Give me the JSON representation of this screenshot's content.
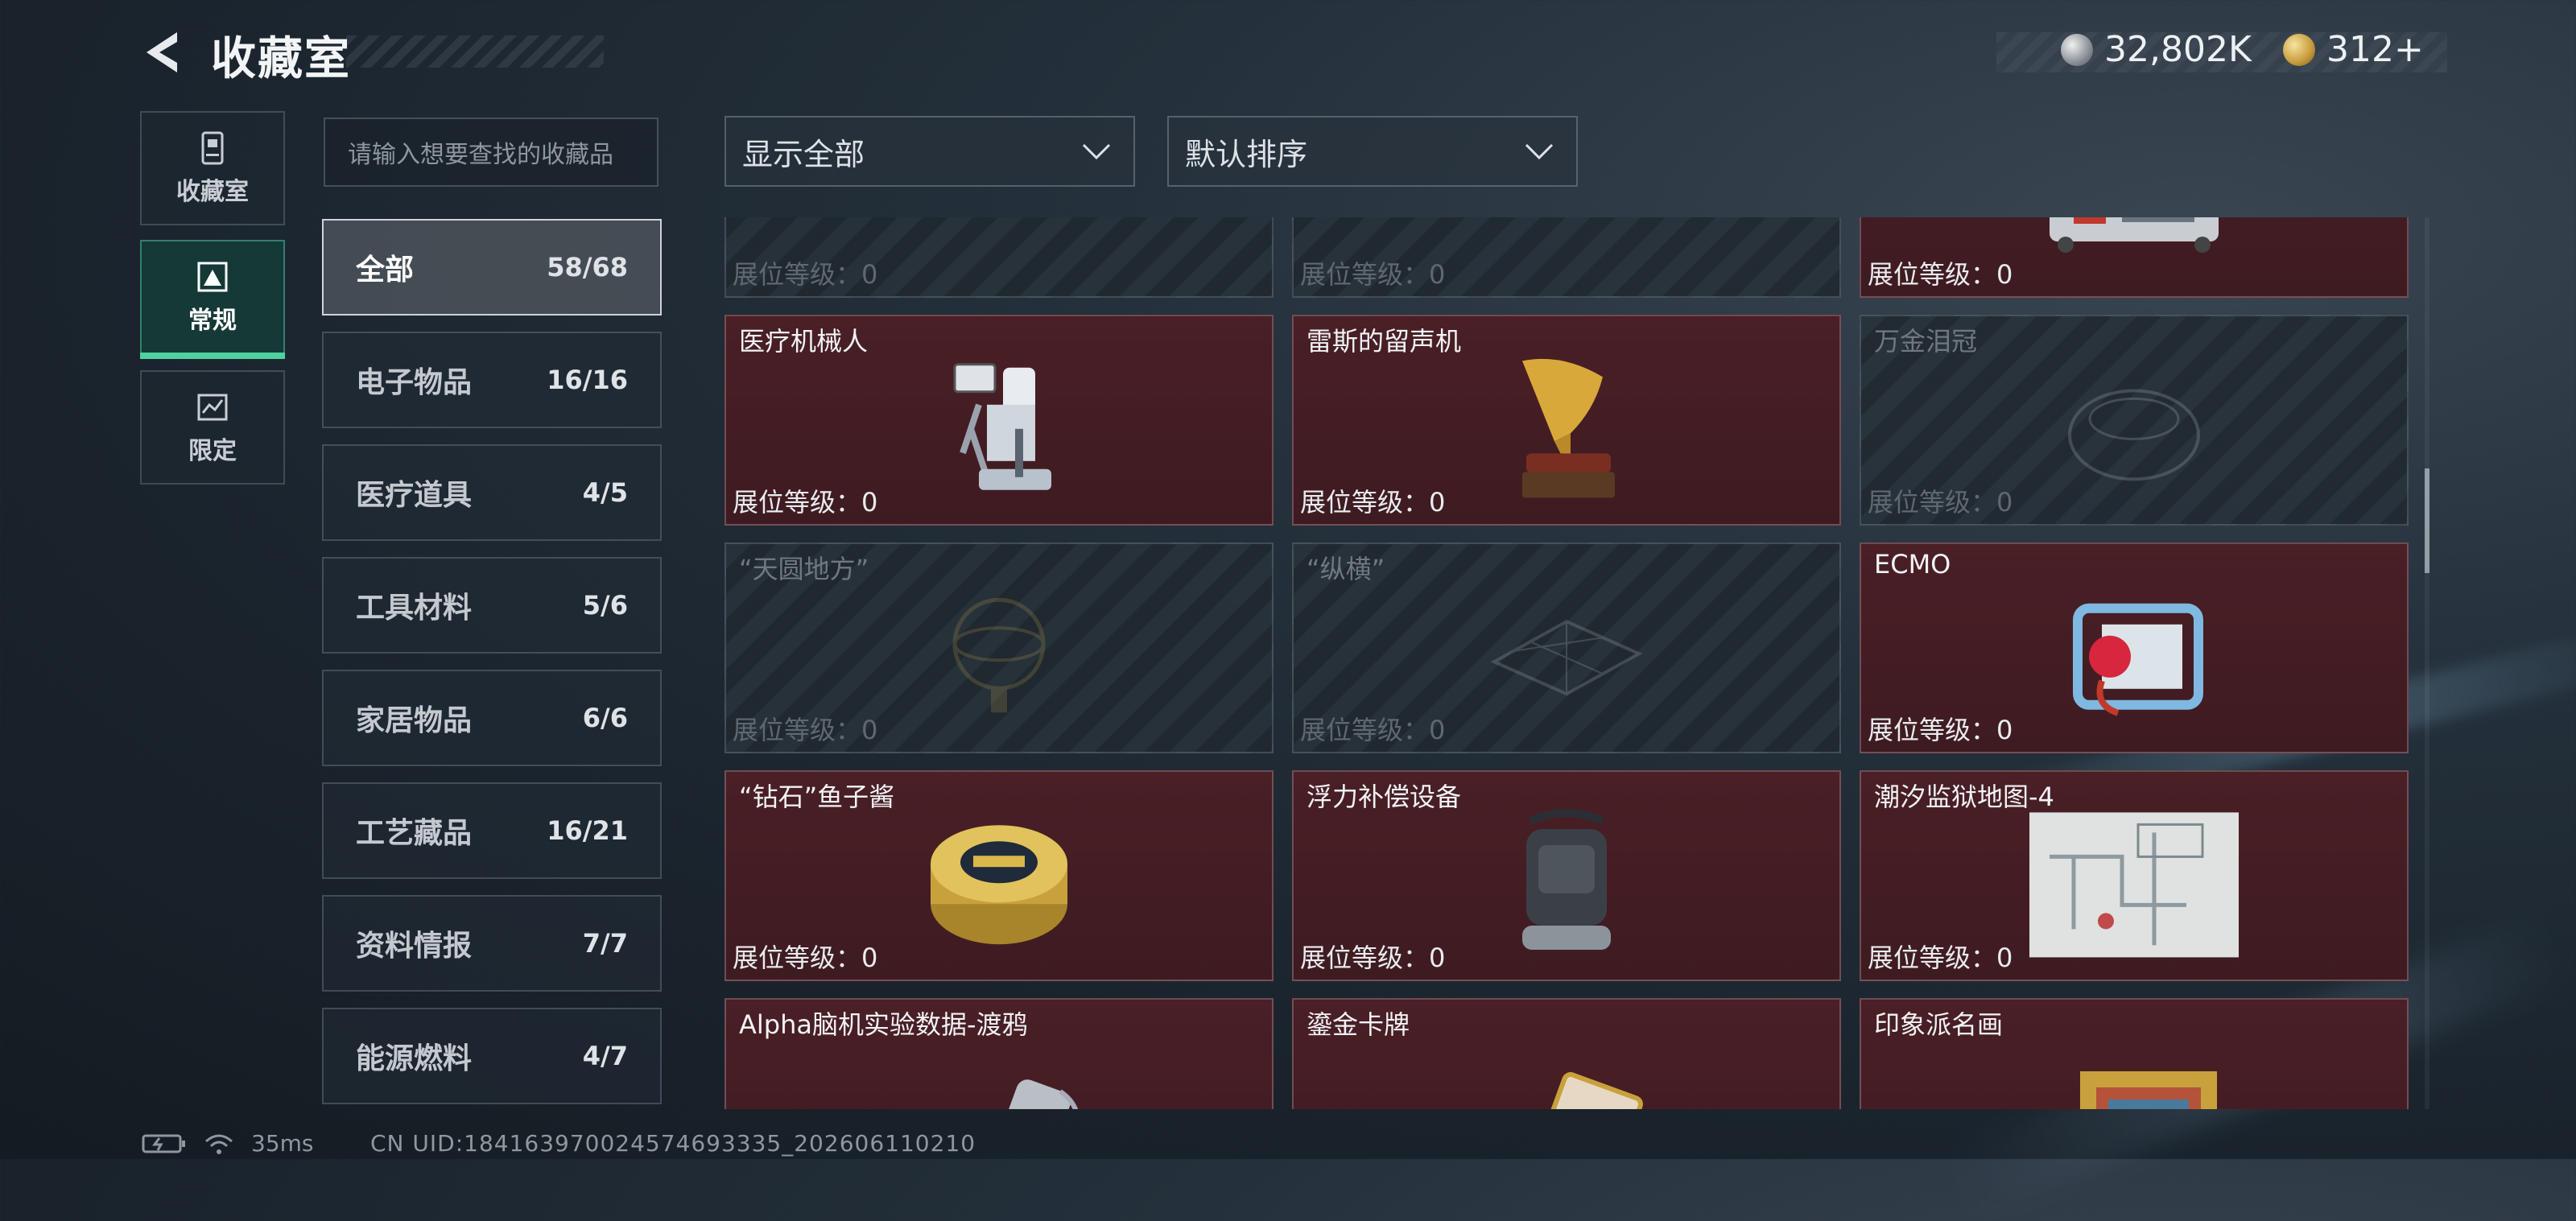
{
  "header": {
    "title": "收藏室",
    "currency": [
      {
        "icon": "silver-coin-icon",
        "value": "32,802K"
      },
      {
        "icon": "gold-coin-icon",
        "value": "312+"
      }
    ]
  },
  "rail": [
    {
      "label": "收藏室",
      "icon": "collection-room-icon",
      "active": false
    },
    {
      "label": "常规",
      "icon": "regular-icon",
      "active": true
    },
    {
      "label": "限定",
      "icon": "limited-icon",
      "active": false
    }
  ],
  "search": {
    "placeholder": "请输入想要查找的收藏品"
  },
  "categories": [
    {
      "label": "全部",
      "count": "58/68",
      "active": true
    },
    {
      "label": "电子物品",
      "count": "16/16"
    },
    {
      "label": "医疗道具",
      "count": "4/5"
    },
    {
      "label": "工具材料",
      "count": "5/6"
    },
    {
      "label": "家居物品",
      "count": "6/6"
    },
    {
      "label": "工艺藏品",
      "count": "16/21"
    },
    {
      "label": "资料情报",
      "count": "7/7"
    },
    {
      "label": "能源燃料",
      "count": "4/7"
    }
  ],
  "filters": {
    "display": "显示全部",
    "sort": "默认排序"
  },
  "level_label": "展位等级：0",
  "items": [
    {
      "name": "",
      "locked": true,
      "icon": "device-icon"
    },
    {
      "name": "",
      "locked": true,
      "icon": "device-icon"
    },
    {
      "name": "",
      "locked": false,
      "icon": "machine-icon"
    },
    {
      "name": "医疗机械人",
      "locked": false,
      "icon": "medical-robot-icon"
    },
    {
      "name": "雷斯的留声机",
      "locked": false,
      "icon": "gramophone-icon"
    },
    {
      "name": "万金泪冠",
      "locked": true,
      "icon": "crown-icon"
    },
    {
      "name": "“天圆地方”",
      "locked": true,
      "icon": "armillary-icon"
    },
    {
      "name": "“纵横”",
      "locked": true,
      "icon": "board-game-icon"
    },
    {
      "name": "ECMO",
      "locked": false,
      "icon": "ecmo-icon"
    },
    {
      "name": "“钻石”鱼子酱",
      "locked": false,
      "icon": "caviar-tin-icon"
    },
    {
      "name": "浮力补偿设备",
      "locked": false,
      "icon": "buoyancy-device-icon"
    },
    {
      "name": "潮汐监狱地图-4",
      "locked": false,
      "icon": "map-icon"
    },
    {
      "name": "Alpha脑机实验数据-渡鸦",
      "locked": false,
      "icon": "data-drive-icon"
    },
    {
      "name": "鎏金卡牌",
      "locked": false,
      "icon": "gilded-card-icon"
    },
    {
      "name": "印象派名画",
      "locked": false,
      "icon": "painting-icon"
    }
  ],
  "status": {
    "ping": "35ms",
    "uid": "CN UID:184163970024574693335_202606110210"
  },
  "colors": {
    "accent": "#4fd0a0",
    "card_owned": "#4a1f26"
  }
}
